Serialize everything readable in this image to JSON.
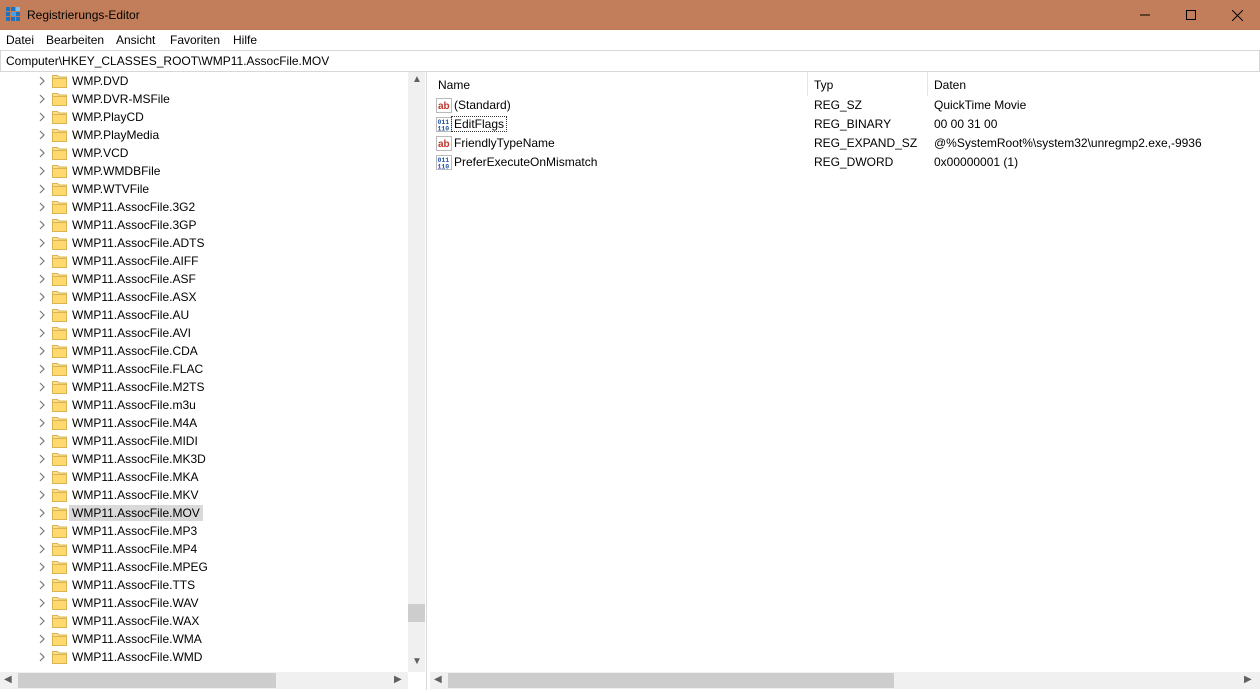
{
  "window": {
    "title": "Registrierungs-Editor"
  },
  "menu": [
    "Datei",
    "Bearbeiten",
    "Ansicht",
    "Favoriten",
    "Hilfe"
  ],
  "address": "Computer\\HKEY_CLASSES_ROOT\\WMP11.AssocFile.MOV",
  "tree": {
    "selected_index": 24,
    "items": [
      "WMP.DVD",
      "WMP.DVR-MSFile",
      "WMP.PlayCD",
      "WMP.PlayMedia",
      "WMP.VCD",
      "WMP.WMDBFile",
      "WMP.WTVFile",
      "WMP11.AssocFile.3G2",
      "WMP11.AssocFile.3GP",
      "WMP11.AssocFile.ADTS",
      "WMP11.AssocFile.AIFF",
      "WMP11.AssocFile.ASF",
      "WMP11.AssocFile.ASX",
      "WMP11.AssocFile.AU",
      "WMP11.AssocFile.AVI",
      "WMP11.AssocFile.CDA",
      "WMP11.AssocFile.FLAC",
      "WMP11.AssocFile.M2TS",
      "WMP11.AssocFile.m3u",
      "WMP11.AssocFile.M4A",
      "WMP11.AssocFile.MIDI",
      "WMP11.AssocFile.MK3D",
      "WMP11.AssocFile.MKA",
      "WMP11.AssocFile.MKV",
      "WMP11.AssocFile.MOV",
      "WMP11.AssocFile.MP3",
      "WMP11.AssocFile.MP4",
      "WMP11.AssocFile.MPEG",
      "WMP11.AssocFile.TTS",
      "WMP11.AssocFile.WAV",
      "WMP11.AssocFile.WAX",
      "WMP11.AssocFile.WMA",
      "WMP11.AssocFile.WMD"
    ]
  },
  "columns": {
    "name": "Name",
    "type": "Typ",
    "data": "Daten"
  },
  "values": [
    {
      "name": "(Standard)",
      "type": "REG_SZ",
      "data": "QuickTime Movie",
      "icon": "string-value-icon"
    },
    {
      "name": "EditFlags",
      "type": "REG_BINARY",
      "data": "00 00 31 00",
      "icon": "binary-value-icon"
    },
    {
      "name": "FriendlyTypeName",
      "type": "REG_EXPAND_SZ",
      "data": "@%SystemRoot%\\system32\\unregmp2.exe,-9936",
      "icon": "string-value-icon"
    },
    {
      "name": "PreferExecuteOnMismatch",
      "type": "REG_DWORD",
      "data": "0x00000001 (1)",
      "icon": "binary-value-icon"
    }
  ],
  "colors": {
    "titlebar": "#c27e5a",
    "selection": "#d9d9d9",
    "folder": "#ffe08a"
  }
}
